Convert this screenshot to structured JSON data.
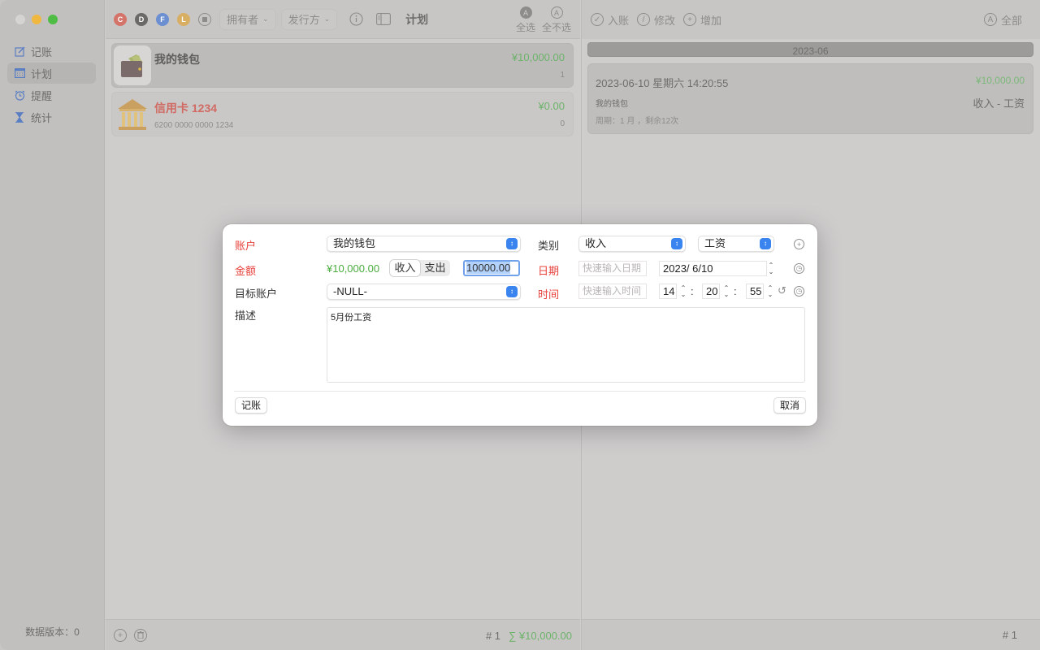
{
  "sidebar": {
    "items": [
      {
        "label": "记账",
        "icon": "edit-icon"
      },
      {
        "label": "计划",
        "icon": "calendar-icon",
        "active": true
      },
      {
        "label": "提醒",
        "icon": "alarm-icon"
      },
      {
        "label": "统计",
        "icon": "hourglass-icon"
      }
    ],
    "footer": "数据版本：0"
  },
  "toolbar": {
    "filters": [
      "C",
      "D",
      "F",
      "L"
    ],
    "owner_label": "拥有者",
    "issuer_label": "发行方",
    "title": "计划",
    "select_all": "全选",
    "select_none": "全不选",
    "select_all_glyph": "A"
  },
  "accounts": [
    {
      "name": "我的钱包",
      "amount": "¥10,000.00",
      "sub": "",
      "count": "1",
      "icon": "wallet-icon",
      "selected": true
    },
    {
      "name": "信用卡 1234",
      "amount": "¥0.00",
      "sub": "6200 0000 0000 1234",
      "count": "0",
      "icon": "bank-icon",
      "selected": false
    }
  ],
  "mid_footer": {
    "count": "# 1",
    "sum": "∑ ¥10,000.00"
  },
  "right_toolbar": {
    "post": "入账",
    "edit": "修改",
    "add": "增加",
    "all": "全部"
  },
  "month_header": "2023-06",
  "record": {
    "datetime": "2023-06-10 星期六 14:20:55",
    "amount": "¥10,000.00",
    "account": "我的钱包",
    "category": "收入 - 工资",
    "period": "周期：1  月  ，剩余12次"
  },
  "right_footer": {
    "count": "# 1"
  },
  "modal": {
    "labels": {
      "account": "账户",
      "amount": "金额",
      "target": "目标账户",
      "desc": "描述",
      "category": "类别",
      "date": "日期",
      "time": "时间"
    },
    "account_value": "我的钱包",
    "amount_display": "¥10,000.00",
    "seg_income": "收入",
    "seg_expense": "支出",
    "amount_input": "10000.00",
    "target_value": "-NULL-",
    "category_type": "收入",
    "category_sub": "工资",
    "date_quick_placeholder": "快速输入日期",
    "date_value": "2023/ 6/10",
    "time_quick_placeholder": "快速输入时间",
    "hour": "14",
    "minute": "20",
    "second": "55",
    "description": "5月份工资",
    "submit": "记账",
    "cancel": "取消"
  }
}
